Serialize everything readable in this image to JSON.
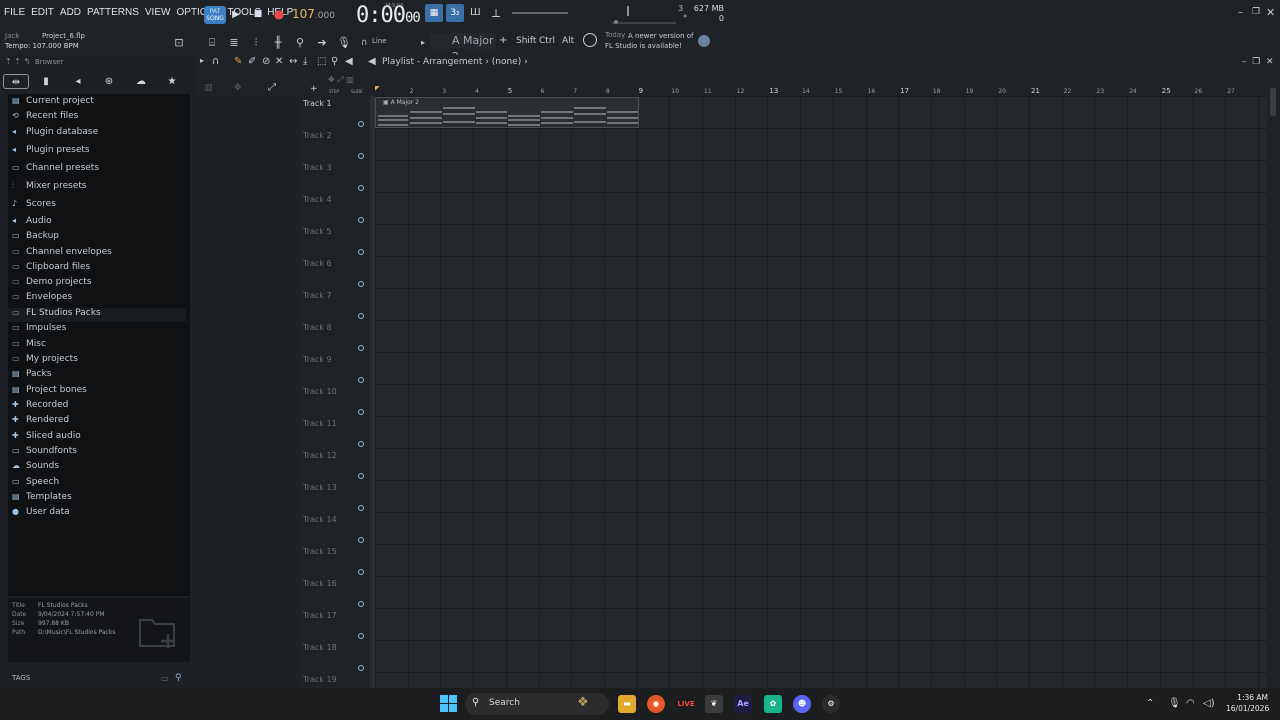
{
  "menu": [
    "FILE",
    "EDIT",
    "ADD",
    "PATTERNS",
    "VIEW",
    "OPTIONS",
    "TOOLS",
    "HELP"
  ],
  "transport": {
    "song_label": "SONG",
    "pat_label": "PAT",
    "tempo": "107",
    "tempo_decimal": ".000",
    "time_main": "0:00",
    "time_cs": "00",
    "time_format": "M:S:CS",
    "cpu_value": "3",
    "memory": "627 MB",
    "memory_voices": "0"
  },
  "hint": {
    "user": "Jack",
    "project": "Project_6.flp",
    "tempo": "Tempo: 107.000 BPM"
  },
  "toolbar": {
    "snap": "Line",
    "pattern_name": "A Major 2",
    "add": "+",
    "mod_shift": "Shift",
    "mod_ctrl": "Ctrl",
    "mod_alt": "Alt",
    "news_today": "Today",
    "news_text": "A newer version of FL Studio is available!"
  },
  "browser": {
    "title": "Browser",
    "items": [
      {
        "label": "Current project",
        "icon": "current-project-icon",
        "glyph": "▤"
      },
      {
        "label": "Recent files",
        "icon": "recent-files-icon",
        "glyph": "⟲"
      },
      {
        "label": "Plugin database",
        "icon": "plugin-database-icon",
        "glyph": "◂"
      },
      {
        "label": "Plugin presets",
        "icon": "plugin-presets-icon",
        "glyph": "◂"
      },
      {
        "label": "Channel presets",
        "icon": "channel-presets-icon",
        "glyph": "▭"
      },
      {
        "label": "Mixer presets",
        "icon": "mixer-presets-icon",
        "glyph": "⫶"
      },
      {
        "label": "Scores",
        "icon": "scores-icon",
        "glyph": "♪"
      },
      {
        "label": "Audio",
        "icon": "audio-icon",
        "glyph": "◂"
      },
      {
        "label": "Backup",
        "icon": "backup-icon",
        "glyph": "▭"
      },
      {
        "label": "Channel envelopes",
        "icon": "folder-icon",
        "glyph": "▭"
      },
      {
        "label": "Clipboard files",
        "icon": "folder-icon",
        "glyph": "▭"
      },
      {
        "label": "Demo projects",
        "icon": "folder-icon",
        "glyph": "▭"
      },
      {
        "label": "Envelopes",
        "icon": "folder-icon",
        "glyph": "▭"
      },
      {
        "label": "FL Studios Packs",
        "icon": "folder-icon",
        "glyph": "▭"
      },
      {
        "label": "Impulses",
        "icon": "folder-icon",
        "glyph": "▭"
      },
      {
        "label": "Misc",
        "icon": "folder-icon",
        "glyph": "▭"
      },
      {
        "label": "My projects",
        "icon": "folder-icon",
        "glyph": "▭"
      },
      {
        "label": "Packs",
        "icon": "packs-icon",
        "glyph": "▤"
      },
      {
        "label": "Project bones",
        "icon": "project-bones-icon",
        "glyph": "▤"
      },
      {
        "label": "Recorded",
        "icon": "recorded-icon",
        "glyph": "✚"
      },
      {
        "label": "Rendered",
        "icon": "rendered-icon",
        "glyph": "✚"
      },
      {
        "label": "Sliced audio",
        "icon": "sliced-audio-icon",
        "glyph": "✚"
      },
      {
        "label": "Soundfonts",
        "icon": "soundfonts-icon",
        "glyph": "▭"
      },
      {
        "label": "Sounds",
        "icon": "sounds-icon",
        "glyph": "☁"
      },
      {
        "label": "Speech",
        "icon": "speech-icon",
        "glyph": "▭"
      },
      {
        "label": "Templates",
        "icon": "templates-icon",
        "glyph": "▤"
      },
      {
        "label": "User data",
        "icon": "user-data-icon",
        "glyph": "●"
      }
    ],
    "selected_index": 13,
    "info": {
      "title_key": "Title",
      "title_val": "FL Studios Packs",
      "date_key": "Date",
      "date_val": "9/04/2024 7:57:40 PM",
      "size_key": "Size",
      "size_val": "997.88 KB",
      "path_key": "Path",
      "path_val": "D:\\Music\\FL Studios Packs"
    },
    "tags_label": "TAGS"
  },
  "playlist": {
    "title": "Playlist - Arrangement",
    "sep": "›",
    "clip_filter": "(none)",
    "step_label": "STEP",
    "slide_label": "SLIDE",
    "tracks": [
      "Track 1",
      "Track 2",
      "Track 3",
      "Track 4",
      "Track 5",
      "Track 6",
      "Track 7",
      "Track 8",
      "Track 9",
      "Track 10",
      "Track 11",
      "Track 12",
      "Track 13",
      "Track 14",
      "Track 15",
      "Track 16",
      "Track 17",
      "Track 18",
      "Track 19"
    ],
    "bars": [
      "2",
      "3",
      "4",
      "5",
      "6",
      "7",
      "8",
      "9",
      "10",
      "11",
      "12",
      "13",
      "14",
      "15",
      "16",
      "17",
      "18",
      "19",
      "20",
      "21",
      "22",
      "23",
      "24",
      "25",
      "26",
      "27"
    ],
    "clip_label": "A Major 2"
  },
  "taskbar": {
    "search": "Search",
    "time": "1:36 AM",
    "date": "16/01/2026",
    "live_label": "LIVE",
    "ae_label": "Ae"
  },
  "colors": {
    "accent": "#3f7fc4",
    "record": "#e64b4b",
    "tempo": "#e6b85a",
    "grid_bg": "#25292d"
  }
}
